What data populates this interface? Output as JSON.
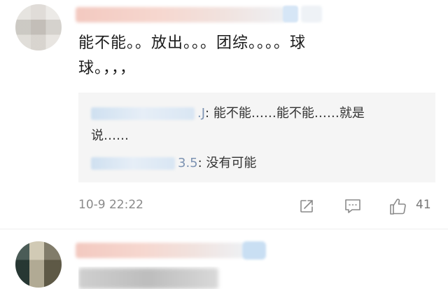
{
  "comment": {
    "line1": "能不能。。放出。。。团综。。。。球",
    "line2": "球。，，，",
    "replies": [
      {
        "user_tail": ".J",
        "text": ": 能不能……能不能……就是"
      },
      {
        "continuation": "说……"
      },
      {
        "user_tail": "3.5",
        "text": ": 没有可能"
      }
    ],
    "timestamp": "10-9 22:22",
    "like_count": "41"
  },
  "icons": {
    "share": "share-icon",
    "reply": "comment-icon",
    "like": "thumbs-up-icon"
  }
}
